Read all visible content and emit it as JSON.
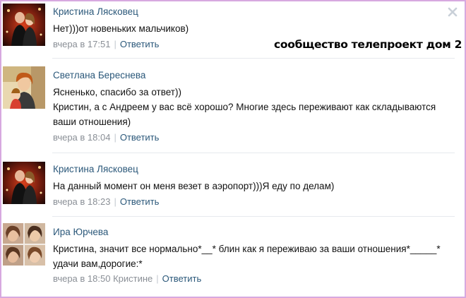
{
  "watermark": "сообщество телепроект дом 2",
  "colors": {
    "frame": "#d7a9e0",
    "link": "#2b587a",
    "meta": "#8a8f96"
  },
  "icons": {
    "close": "close-icon"
  },
  "comments": [
    {
      "author": "Кристина Лясковец",
      "lines": [
        "Нет)))от новеньких мальчиков)"
      ],
      "time": "вчера в 17:51",
      "reply_to": "",
      "reply": "Ответить"
    },
    {
      "author": "Светлана Береснева",
      "lines": [
        "Ясненько, спасибо за ответ))",
        "Кристин, а с Андреем у вас всё хорошо? Многие здесь переживают как складываются ваши отношения)"
      ],
      "time": "вчера в 18:04",
      "reply_to": "",
      "reply": "Ответить"
    },
    {
      "author": "Кристина Лясковец",
      "lines": [
        "На данный момент он меня везет в аэропорт)))Я еду по делам)"
      ],
      "time": "вчера в 18:23",
      "reply_to": "",
      "reply": "Ответить"
    },
    {
      "author": "Ира Юрчева",
      "lines": [
        "Кристина, значит все нормально*__* блин как я переживаю за ваши отношения*_____* удачи вам,дорогие:*"
      ],
      "time": "вчера в 18:50",
      "reply_to": "Кристине",
      "reply": "Ответить"
    }
  ]
}
